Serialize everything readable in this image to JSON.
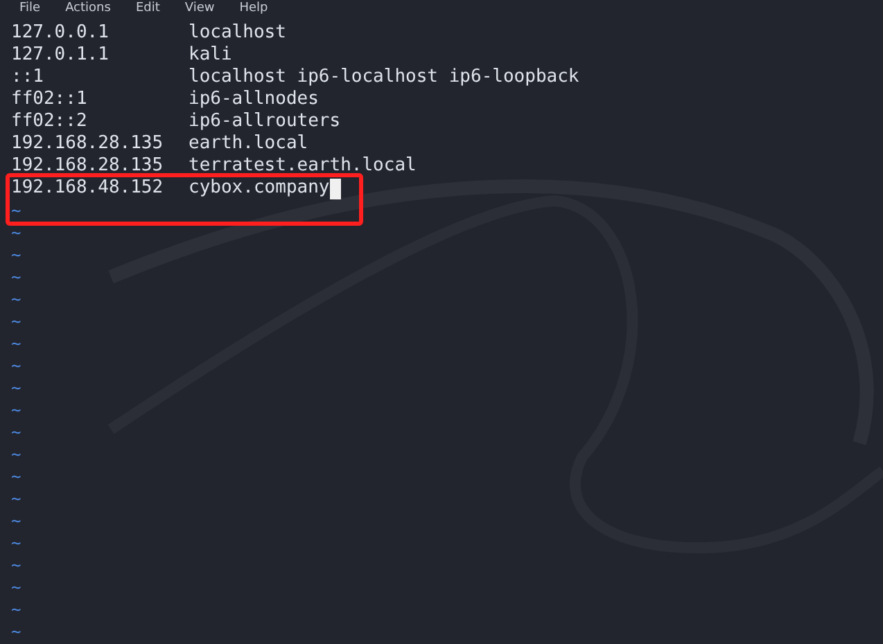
{
  "menu": [
    "File",
    "Actions",
    "Edit",
    "View",
    "Help"
  ],
  "lines": [
    {
      "ip": "127.0.0.1",
      "host": "localhost",
      "cursor": false
    },
    {
      "ip": "127.0.1.1",
      "host": "kali",
      "cursor": false
    },
    {
      "ip": "::1",
      "host": "localhost ip6-localhost ip6-loopback",
      "cursor": false
    },
    {
      "ip": "ff02::1",
      "host": "ip6-allnodes",
      "cursor": false
    },
    {
      "ip": "ff02::2",
      "host": "ip6-allrouters",
      "cursor": false
    },
    {
      "ip": "192.168.28.135",
      "host": "earth.local",
      "cursor": false
    },
    {
      "ip": "192.168.28.135",
      "host": "terratest.earth.local",
      "cursor": false
    },
    {
      "ip": "192.168.48.152",
      "host": "cybox.company",
      "cursor": true
    }
  ],
  "empty_lines": [
    "~",
    "~",
    "~",
    "~",
    "~",
    "~",
    "~",
    "~",
    "~",
    "~",
    "~",
    "~",
    "~",
    "~",
    "~",
    "~",
    "~",
    "~",
    "~",
    "~"
  ]
}
